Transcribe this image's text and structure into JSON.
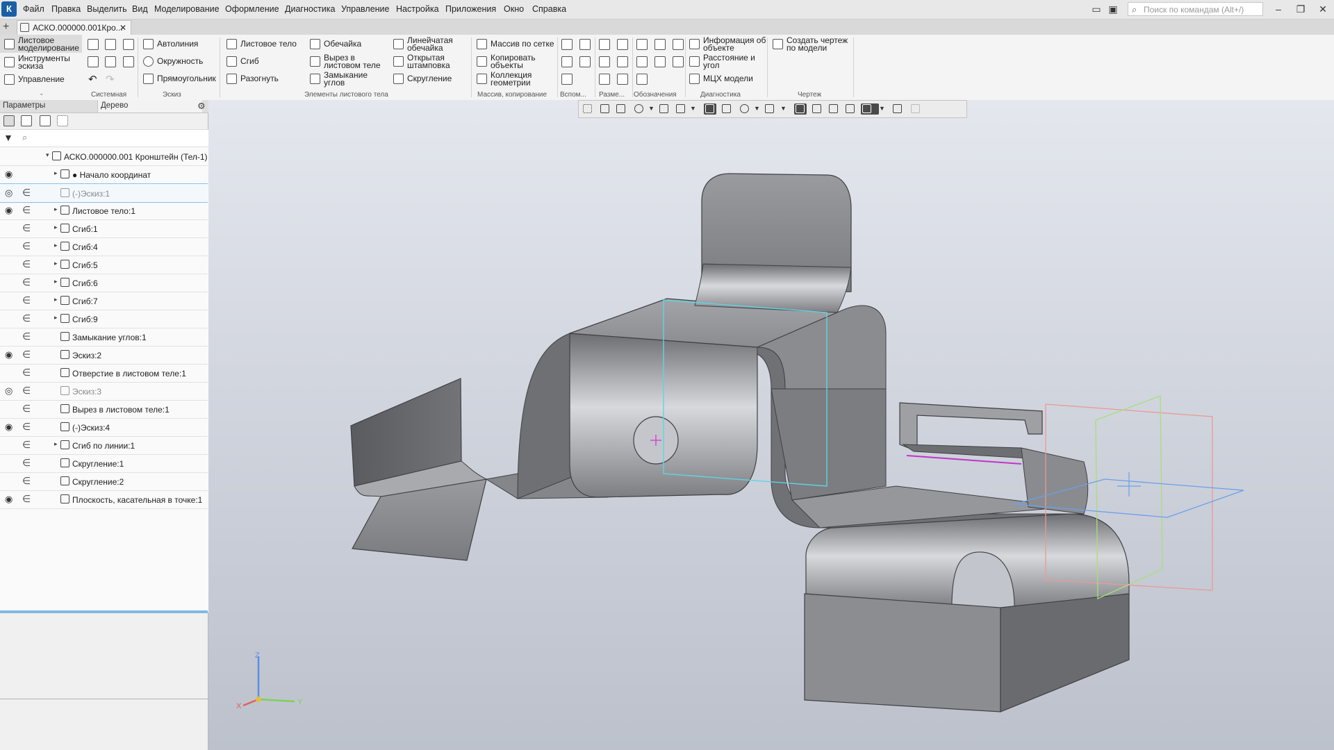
{
  "menu": [
    "Файл",
    "Правка",
    "Выделить",
    "Вид",
    "Моделирование",
    "Оформление",
    "Диагностика",
    "Управление",
    "Настройка",
    "Приложения",
    "Окно",
    "Справка"
  ],
  "command_search_placeholder": "Поиск по командам (Alt+/)",
  "document_tab": "АСКО.000000.001Кро...",
  "ribbon": {
    "modes": [
      "Листовое моделирование",
      "Инструменты эскиза",
      "Управление"
    ],
    "sketch": [
      "Автолиния",
      "Окружность",
      "Прямоугольник"
    ],
    "sheet": [
      "Листовое тело",
      "Сгиб",
      "Разогнуть",
      "Обечайка",
      "Вырез в листовом теле",
      "Замыкание углов",
      "Линейчатая обечайка",
      "Открытая штамповка",
      "Скругление"
    ],
    "array": [
      "Массив по сетке",
      "Копировать объекты",
      "Коллекция геометрии"
    ],
    "diagnostics": [
      "Информация об объекте",
      "Расстояние и угол",
      "МЦХ модели"
    ],
    "drawing": [
      "Создать чертеж по модели"
    ],
    "groups": [
      "Системная",
      "Эскиз",
      "Элементы листового тела",
      "Массив, копирование",
      "Вспом...",
      "Разме...",
      "Обозначения",
      "Диагностика",
      "Чертеж"
    ]
  },
  "panel": {
    "tab_params": "Параметры",
    "tab_tree": "Дерево",
    "filter_icon": "search-icon"
  },
  "tree": [
    {
      "label": "АСКО.000000.001 Кронштейн (Тел-1)",
      "eye": "",
      "rel": "",
      "level": 0,
      "arrow": "▾",
      "grey": false
    },
    {
      "label": "● Начало координат",
      "eye": "◉",
      "rel": "",
      "level": 1,
      "arrow": "▸",
      "grey": false
    },
    {
      "label": "(-)Эскиз:1",
      "eye": "◎",
      "rel": "∈",
      "level": 1,
      "arrow": "",
      "grey": true
    },
    {
      "label": "Листовое тело:1",
      "eye": "◉",
      "rel": "∈",
      "level": 1,
      "arrow": "▸",
      "grey": false
    },
    {
      "label": "Сгиб:1",
      "eye": "",
      "rel": "∈",
      "level": 1,
      "arrow": "▸",
      "grey": false
    },
    {
      "label": "Сгиб:4",
      "eye": "",
      "rel": "∈",
      "level": 1,
      "arrow": "▸",
      "grey": false
    },
    {
      "label": "Сгиб:5",
      "eye": "",
      "rel": "∈",
      "level": 1,
      "arrow": "▸",
      "grey": false
    },
    {
      "label": "Сгиб:6",
      "eye": "",
      "rel": "∈",
      "level": 1,
      "arrow": "▸",
      "grey": false
    },
    {
      "label": "Сгиб:7",
      "eye": "",
      "rel": "∈",
      "level": 1,
      "arrow": "▸",
      "grey": false
    },
    {
      "label": "Сгиб:9",
      "eye": "",
      "rel": "∈",
      "level": 1,
      "arrow": "▸",
      "grey": false
    },
    {
      "label": "Замыкание углов:1",
      "eye": "",
      "rel": "∈",
      "level": 1,
      "arrow": "",
      "grey": false
    },
    {
      "label": "Эскиз:2",
      "eye": "◉",
      "rel": "∈",
      "level": 1,
      "arrow": "",
      "grey": false
    },
    {
      "label": "Отверстие в листовом теле:1",
      "eye": "",
      "rel": "∈",
      "level": 1,
      "arrow": "",
      "grey": false
    },
    {
      "label": "Эскиз:3",
      "eye": "◎",
      "rel": "∈",
      "level": 1,
      "arrow": "",
      "grey": true
    },
    {
      "label": "Вырез в листовом теле:1",
      "eye": "",
      "rel": "∈",
      "level": 1,
      "arrow": "",
      "grey": false
    },
    {
      "label": "(-)Эскиз:4",
      "eye": "◉",
      "rel": "∈",
      "level": 1,
      "arrow": "",
      "grey": false
    },
    {
      "label": "Сгиб по линии:1",
      "eye": "",
      "rel": "∈",
      "level": 1,
      "arrow": "▸",
      "grey": false
    },
    {
      "label": "Скругление:1",
      "eye": "",
      "rel": "∈",
      "level": 1,
      "arrow": "",
      "grey": false
    },
    {
      "label": "Скругление:2",
      "eye": "",
      "rel": "∈",
      "level": 1,
      "arrow": "",
      "grey": false
    },
    {
      "label": "Плоскость, касательная в точке:1",
      "eye": "◉",
      "rel": "∈",
      "level": 1,
      "arrow": "",
      "grey": false
    }
  ],
  "triad": {
    "x": "X",
    "y": "Y",
    "z": "Z"
  },
  "colors": {
    "accent": "#1a5fa6",
    "selection": "#7fb9e6",
    "part": "#8c8d90",
    "sketch_outline": "#5fd4e2"
  }
}
